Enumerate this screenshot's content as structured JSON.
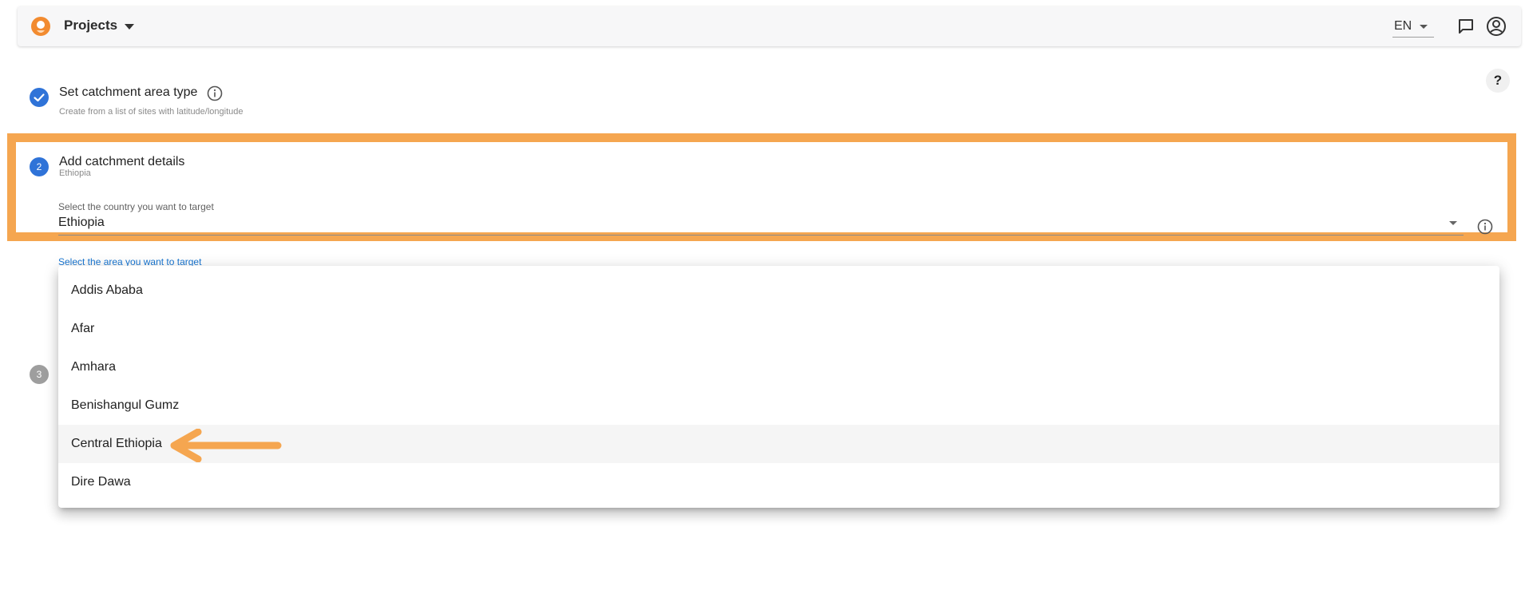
{
  "header": {
    "title": "Projects",
    "language": "EN"
  },
  "help_label": "?",
  "steps": [
    {
      "number": "1",
      "title": "Set catchment area type",
      "subtitle": "Create from a list of sites with latitude/longitude",
      "status": "completed"
    },
    {
      "number": "2",
      "title": "Add catchment details",
      "subtitle": "Ethiopia",
      "status": "active"
    },
    {
      "number": "3",
      "status": "pending"
    }
  ],
  "country_field": {
    "label": "Select the country you want to target",
    "value": "Ethiopia"
  },
  "area_field": {
    "label": "Select the area you want to target"
  },
  "area_options": [
    "Addis Ababa",
    "Afar",
    "Amhara",
    "Benishangul Gumz",
    "Central Ethiopia",
    "Dire Dawa"
  ],
  "highlighted_option": "Central Ethiopia",
  "colors": {
    "accent_blue": "#2f73d8",
    "highlight_orange": "#f5a650",
    "pending_gray": "#9e9e9e",
    "logo_orange": "#f28b30"
  }
}
